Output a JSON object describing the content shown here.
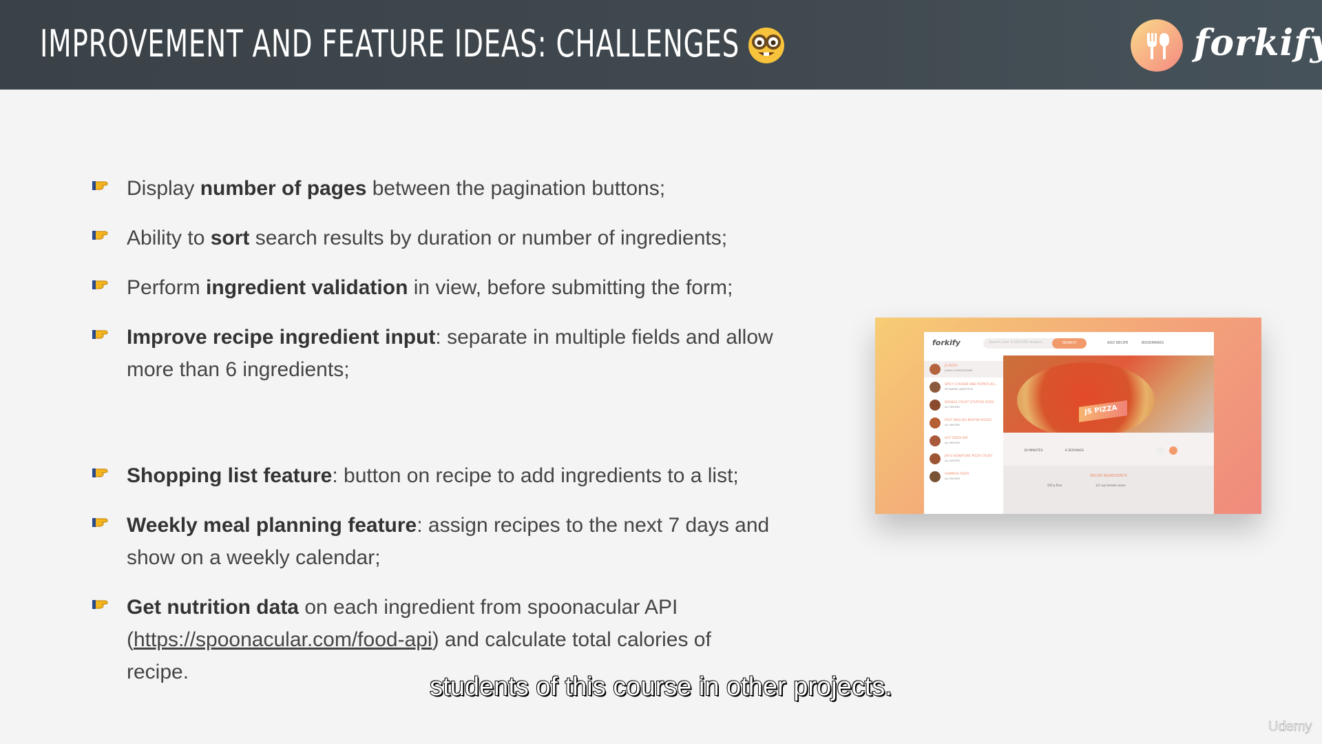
{
  "header": {
    "title": "IMPROVEMENT AND FEATURE IDEAS: CHALLENGES",
    "emoji_icon": "nerd-face-icon",
    "logo_text": "forkify",
    "logo_icon": "fork-spoon-icon"
  },
  "bullets": [
    {
      "bold_first": false,
      "before": "Display ",
      "bold": "number of pages",
      "after": " between the pagination buttons;"
    },
    {
      "bold_first": false,
      "before": "Ability to ",
      "bold": "sort",
      "after": " search results by duration or number of ingredients;"
    },
    {
      "bold_first": false,
      "before": "Perform ",
      "bold": "ingredient validation",
      "after": " in view, before submitting the form;"
    },
    {
      "bold_first": true,
      "before": "",
      "bold": "Improve recipe ingredient input",
      "after": ": separate in multiple fields and allow more than 6 ingredients;"
    },
    {
      "bold_first": true,
      "before": "",
      "bold": "Shopping list feature",
      "after": ": button on recipe to add ingredients to a list;"
    },
    {
      "bold_first": true,
      "before": "",
      "bold": "Weekly meal planning feature",
      "after": ": assign recipes to the next 7 days and show on a weekly calendar;"
    },
    {
      "bold_first": true,
      "before": "",
      "bold": "Get nutrition data",
      "after": " on each ingredient from spoonacular API (",
      "link": "https://spoonacular.com/food-api",
      "tail": ") and calculate total calories of recipe."
    }
  ],
  "screenshot": {
    "logo": "forkify",
    "search_placeholder": "Search over 1,000,000 recipes...",
    "search_button": "SEARCH",
    "add_recipe": "ADD RECIPE",
    "bookmarks": "BOOKMARKS",
    "recipes": [
      {
        "title": "JS PIZZA",
        "publisher": "JONAS SCHMEDTMANN"
      },
      {
        "title": "SPICY CHICKEN AND PEPPER JAC...",
        "publisher": "MY BAKING ADDICTION"
      },
      {
        "title": "DOUBLE CRUST STUFFED PIZZA",
        "publisher": "ALL RECIPES"
      },
      {
        "title": "FAST ENGLISH MUFFIN PIZZAS",
        "publisher": "ALL RECIPES"
      },
      {
        "title": "HOT PIZZA DIP",
        "publisher": "ALL RECIPES"
      },
      {
        "title": "JAY'S SIGNATURE PIZZA CRUST",
        "publisher": "ALL RECIPES"
      },
      {
        "title": "HUMMUS PIZZA",
        "publisher": "ALL RECIPES"
      }
    ],
    "recipe_title": "JS PIZZA",
    "minutes": "30 MINUTES",
    "servings": "6 SERVINGS",
    "ingredients_heading": "RECIPE INGREDIENTS",
    "ingredients": [
      "500 g flour",
      "1/2 cup tomato sauce"
    ]
  },
  "subtitle": "students of this course in other projects.",
  "watermark": "Udemy"
}
